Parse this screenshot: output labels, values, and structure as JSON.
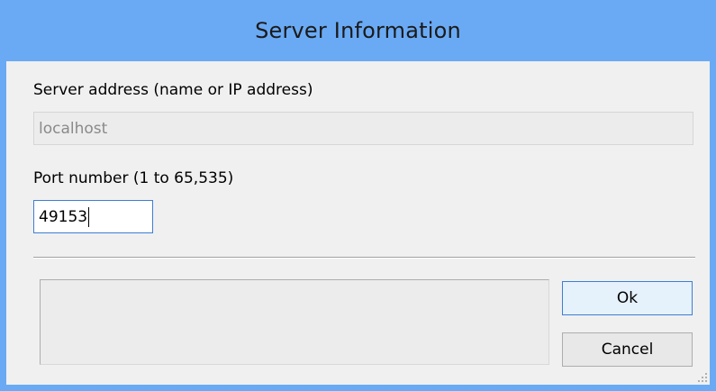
{
  "window": {
    "title": "Server Information"
  },
  "form": {
    "server_address_label": "Server address (name or IP address)",
    "server_address_value": "localhost",
    "port_label": "Port number (1 to 65,535)",
    "port_value": "49153"
  },
  "buttons": {
    "ok_label": "Ok",
    "cancel_label": "Cancel"
  },
  "colors": {
    "titlebar": "#6aaaf4",
    "focus_border": "#3c7fd4"
  }
}
